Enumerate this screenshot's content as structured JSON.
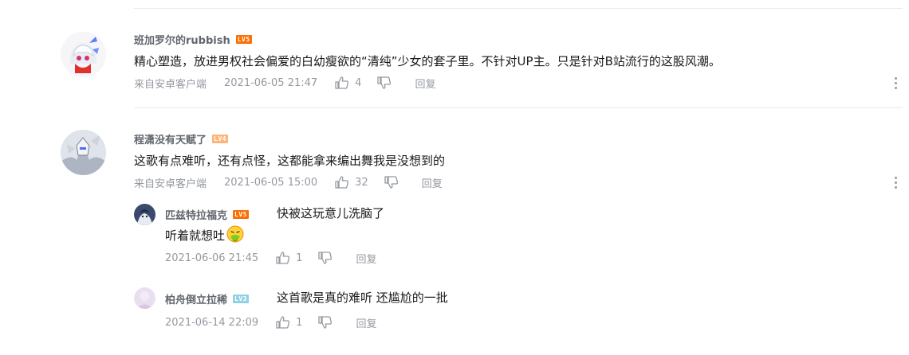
{
  "comments": [
    {
      "username": "班加罗尔的rubbish",
      "level": "LV5",
      "text": "精心塑造，放进男权社会偏爱的白幼瘦欲的“清纯”少女的套子里。不针对UP主。只是针对B站流行的这股风潮。",
      "device": "来自安卓客户端",
      "time": "2021-06-05 21:47",
      "likes": "4",
      "reply_label": "回复"
    },
    {
      "username": "程潇没有天赋了",
      "level": "LV4",
      "text": "这歌有点难听，还有点怪，这都能拿来编出舞我是没想到的",
      "device": "来自安卓客户端",
      "time": "2021-06-05 15:00",
      "likes": "32",
      "reply_label": "回复",
      "replies": [
        {
          "username": "匹兹特拉福克",
          "level": "LV5",
          "text_line1": "快被这玩意儿洗脑了",
          "text_line2": "听着就想吐",
          "time": "2021-06-06 21:45",
          "likes": "1",
          "reply_label": "回复"
        },
        {
          "username": "柏舟倒立拉稀",
          "level": "LV3",
          "text_line1": "这首歌是真的难听 还尴尬的一批",
          "time": "2021-06-14 22:09",
          "likes": "1",
          "reply_label": "回复"
        }
      ]
    }
  ],
  "icons": {
    "like": "thumbs-up-icon",
    "dislike": "thumbs-down-icon",
    "more": "more-vertical-icon",
    "emoji": "vomit-emoji-icon"
  }
}
